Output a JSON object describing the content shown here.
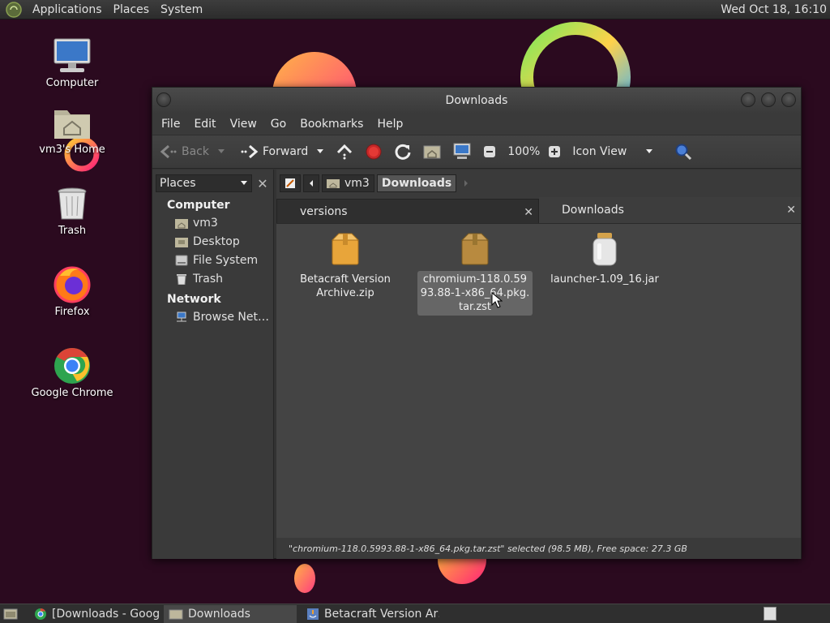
{
  "topbar": {
    "menus": [
      "Applications",
      "Places",
      "System"
    ],
    "clock": "Wed Oct 18, 16:10"
  },
  "desktop": {
    "icons": [
      {
        "label": "Computer",
        "icon": "computer-icon"
      },
      {
        "label": "vm3's Home",
        "icon": "home-folder-icon"
      },
      {
        "label": "Trash",
        "icon": "trash-icon"
      },
      {
        "label": "Firefox",
        "icon": "firefox-icon"
      },
      {
        "label": "Google Chrome",
        "icon": "chrome-icon"
      }
    ]
  },
  "window": {
    "title": "Downloads",
    "menubar": [
      "File",
      "Edit",
      "View",
      "Go",
      "Bookmarks",
      "Help"
    ],
    "toolbar": {
      "back_label": "Back",
      "forward_label": "Forward",
      "zoom": "100%",
      "view_mode": "Icon View"
    },
    "sidebar": {
      "combo_label": "Places",
      "sections": [
        {
          "title": "Computer",
          "items": [
            "vm3",
            "Desktop",
            "File System",
            "Trash"
          ]
        },
        {
          "title": "Network",
          "items": [
            "Browse Net…"
          ]
        }
      ]
    },
    "pathbar": [
      "vm3",
      "Downloads"
    ],
    "tabs": [
      "versions",
      "Downloads"
    ],
    "files": [
      {
        "name": "Betacraft Version Archive.zip",
        "icon": "archive-icon",
        "selected": false
      },
      {
        "name": "chromium-118.0.5993.88-1-x86_64.pkg.tar.zst",
        "icon": "archive-icon",
        "selected": true
      },
      {
        "name": "launcher-1.09_16.jar",
        "icon": "jar-icon",
        "selected": false
      }
    ],
    "status": "\"chromium-118.0.5993.88-1-x86_64.pkg.tar.zst\" selected (98.5 MB), Free space: 27.3 GB"
  },
  "taskbar": {
    "tasks": [
      "[Downloads - Goog…",
      "Downloads",
      "Betacraft Version Ar…"
    ]
  },
  "colors": {
    "wallpaper": "#2b0a1f",
    "window_bg": "#333333",
    "content_bg": "#444444",
    "selection": "#666666"
  }
}
